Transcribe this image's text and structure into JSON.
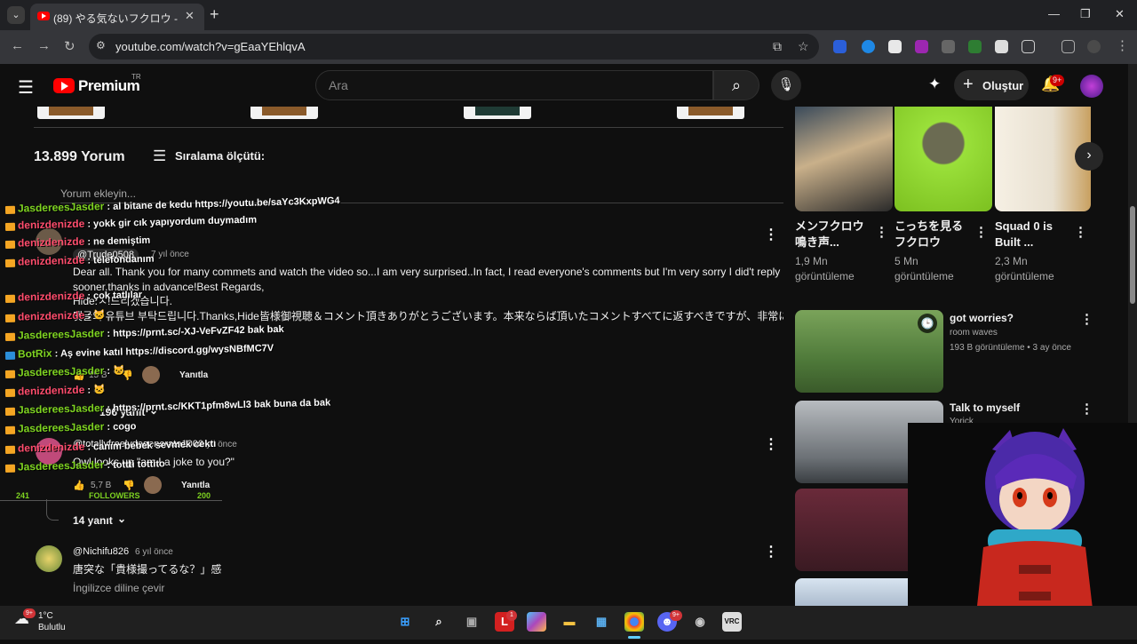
{
  "browser": {
    "tab_title": "(89) やる気ないフクロウ - YouTube",
    "tab_close": "✕",
    "new_tab": "+",
    "url": "youtube.com/watch?v=gEaaYEhlqvA",
    "window_controls": {
      "minimize": "—",
      "maximize": "❐",
      "close": "✕"
    }
  },
  "youtube": {
    "logo": "Premium",
    "country": "TR",
    "search_placeholder": "Ara",
    "create_label": "Oluştur",
    "notif_badge": "9+"
  },
  "comments": {
    "count_label": "13.899 Yorum",
    "sort_label": "Sıralama ölçütü:",
    "add_comment": "Yorum ekleyin...",
    "items": [
      {
        "handle": "@Trude0508",
        "time": "7 yıl önce",
        "lines": [
          "Dear all. Thank you for many commets and watch the video so...I am very surprised..In fact, I read everyone's comments but  I'm very sorry I did't reply",
          "sooner.thanks in advance!Best Regards,",
          "Hide.ㅅ!드리겠습니다.",
          "댓글의 유튜브 부탁드립니다.Thanks,Hide皆様御視聴＆コメント頂きありがとうございます。本来ならば頂いたコメントすべてに返すべきですが、非常に多..."
        ],
        "likes": "15 B",
        "reply_label": "Yanıtla",
        "replies_label": "196 yanıt"
      },
      {
        "handle": "@totallyfreelydegenerate1900",
        "time": "4 yıl önce",
        "text": "Owl looks up \"am I a joke to you?\"",
        "likes": "5,7 B",
        "reply_label": "Yanıtla",
        "replies_label": "14 yanıt"
      },
      {
        "handle": "@Nichifu826",
        "time": "6 yıl önce",
        "text": "唐突な「貴様撮ってるな？」感",
        "translate": "İngilizce diline çevir"
      }
    ]
  },
  "chat_overlay": {
    "rows": [
      {
        "user": "JasdereesJasder",
        "msg": ": al bitane de kedu https://youtu.be/saYc3KxpWG4",
        "color": "#7ed321"
      },
      {
        "user": "denizdenizde",
        "msg": ": yokk gir cık yapıyordum duymadım",
        "color": "#ff4d6d"
      },
      {
        "user": "denizdenizde",
        "msg": ": ne demiştim",
        "color": "#ff4d6d"
      },
      {
        "user": "denizdenizde",
        "msg": ": telefondanım",
        "color": "#ff4d6d"
      },
      {
        "user": "denizdenizde",
        "msg": ": çok tatlılar",
        "color": "#ff4d6d"
      },
      {
        "user": "denizdenizde",
        "msg": ": 🐱",
        "color": "#ff4d6d"
      },
      {
        "user": "JasdereesJasder",
        "msg": ": https://prnt.sc/-XJ-VeFvZF42 bak bak",
        "color": "#7ed321"
      },
      {
        "user": "BotRix",
        "msg": ": Aş evine katıl https://discord.gg/wysNBfMC7V",
        "color": "#7ed321"
      },
      {
        "user": "JasdereesJasder",
        "msg": ": 🐱",
        "color": "#7ed321"
      },
      {
        "user": "denizdenizde",
        "msg": ": 🐱",
        "color": "#ff4d6d"
      },
      {
        "user": "JasdereesJasder",
        "msg": ": https://prnt.sc/KKT1pfm8wLl3 bak buna da bak",
        "color": "#7ed321"
      },
      {
        "user": "JasdereesJasder",
        "msg": ": cogo",
        "color": "#7ed321"
      },
      {
        "user": "denizdenizde",
        "msg": ": canım bebek sevmek cektı",
        "color": "#ff4d6d"
      },
      {
        "user": "JasdereesJasder",
        "msg": ": tottti tottito",
        "color": "#7ed321"
      }
    ],
    "followers_left": "241",
    "followers_label": "FOLLOWERS",
    "followers_right": "200"
  },
  "shorts": [
    {
      "title": "メンフクロウ鳴き声...",
      "views": "1,9 Mn görüntüleme"
    },
    {
      "title": "こっちを見るフクロウ",
      "views": "5 Mn görüntüleme"
    },
    {
      "title": "Squad 0 is Built ...",
      "views": "2,3 Mn görüntüleme"
    }
  ],
  "sidebar_videos": [
    {
      "title": "got worries?",
      "channel": "room waves",
      "meta": "193 B görüntüleme • 3 ay önce"
    },
    {
      "title": "Talk to myself",
      "channel": "Yorick",
      "meta": ""
    }
  ],
  "taskbar": {
    "temp": "1°C",
    "condition": "Bulutlu",
    "weather_badge": "9+",
    "discord_badge": "9+",
    "l_badge": "1"
  },
  "icons": {
    "youtube_red": "#ff0000",
    "accent_green": "#7ed321",
    "accent_pink": "#ff4d6d"
  }
}
